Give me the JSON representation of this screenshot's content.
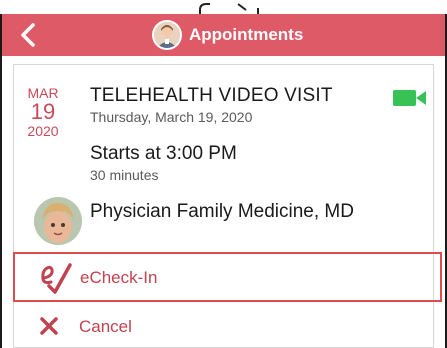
{
  "header": {
    "title": "Appointments",
    "back_icon": "chevron-left-icon",
    "avatar_icon": "user-avatar-icon",
    "background_color": "#de5a66"
  },
  "appointment": {
    "date": {
      "month": "MAR",
      "day": "19",
      "year": "2020"
    },
    "title": "TELEHEALTH VIDEO VISIT",
    "full_date": "Thursday, March 19, 2020",
    "start_text": "Starts at 3:00 PM",
    "duration": "30 minutes",
    "video_icon": "video-camera-icon",
    "video_icon_color": "#38c155",
    "provider": {
      "name": "Physician Family Medicine, MD",
      "avatar_icon": "provider-photo"
    }
  },
  "actions": {
    "echeckin_label": "eCheck-In",
    "echeckin_icon": "echeck-in-icon",
    "cancel_label": "Cancel",
    "cancel_icon": "x-mark-icon",
    "accent_color": "#c0434f",
    "highlight_border_color": "#de4b4b"
  }
}
